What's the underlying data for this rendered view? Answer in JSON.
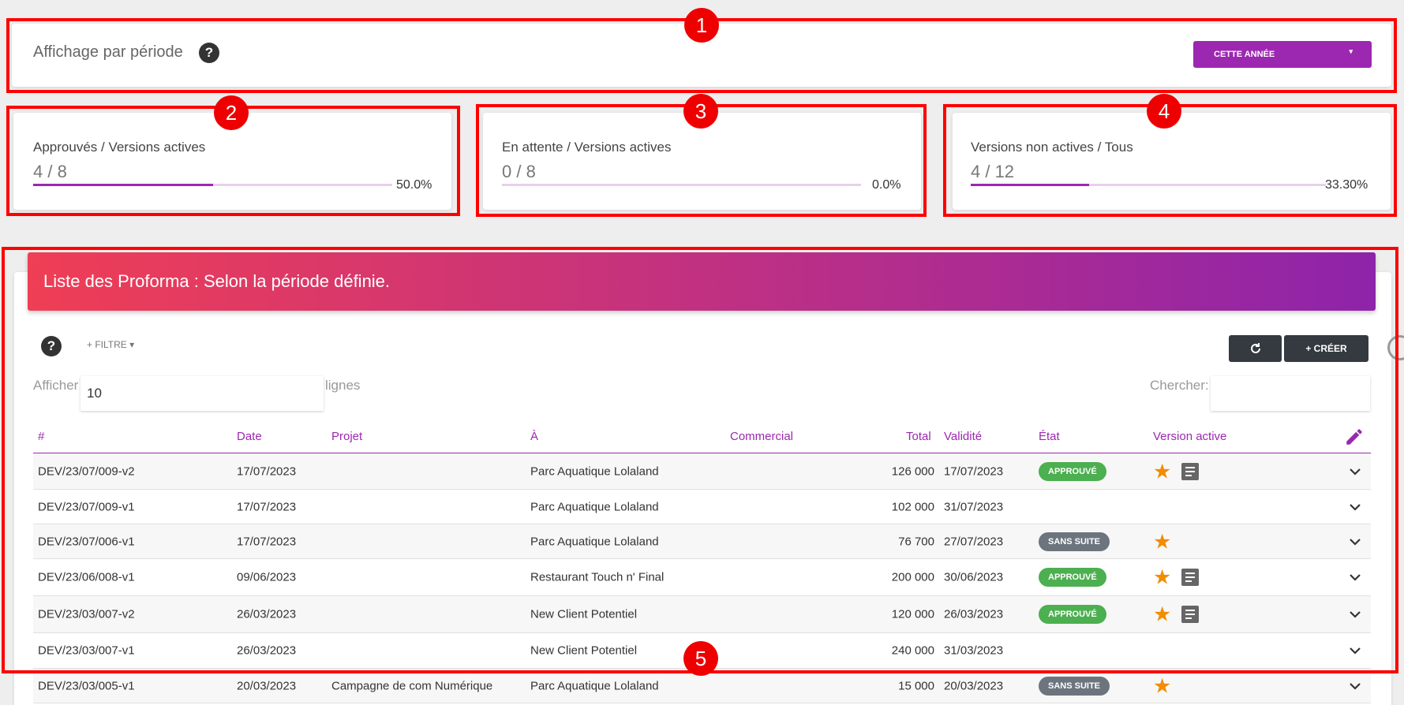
{
  "period": {
    "label": "Affichage par période",
    "help": "?",
    "button_label": "CETTE ANNÉE",
    "button_caret": "▾"
  },
  "stats": [
    {
      "title": "Approuvés / Versions actives",
      "value": "4 / 8",
      "percent": "50.0%",
      "progress": 0.5
    },
    {
      "title": "En attente / Versions actives",
      "value": "0 / 8",
      "percent": "0.0%",
      "progress": 0.0
    },
    {
      "title": "Versions non actives / Tous",
      "value": "4 / 12",
      "percent": "33.30%",
      "progress": 0.333
    }
  ],
  "annotations": [
    "1",
    "2",
    "3",
    "4",
    "5"
  ],
  "list": {
    "banner": "Liste des Proforma : Selon la période définie.",
    "help": "?",
    "filter_label": "+ FILTRE ▾",
    "refresh_icon": "refresh-icon",
    "create_label": "+ CRÉER",
    "show_label": "Afficher",
    "show_value": "10",
    "lines_label": "lignes",
    "search_label": "Chercher:",
    "search_value": "",
    "columns": [
      "#",
      "Date",
      "Projet",
      "À",
      "Commercial",
      "Total",
      "Validité",
      "État",
      "Version active"
    ],
    "rows": [
      {
        "id": "DEV/23/07/009-v2",
        "date": "17/07/2023",
        "projet": "",
        "a": "Parc Aquatique Lolaland",
        "commercial": "",
        "total": "126 000",
        "validite": "17/07/2023",
        "etat": "APPROUVÉ",
        "etat_color": "green",
        "star": true,
        "doc": true
      },
      {
        "id": "DEV/23/07/009-v1",
        "date": "17/07/2023",
        "projet": "",
        "a": "Parc Aquatique Lolaland",
        "commercial": "",
        "total": "102 000",
        "validite": "31/07/2023",
        "etat": "",
        "etat_color": "",
        "star": false,
        "doc": false
      },
      {
        "id": "DEV/23/07/006-v1",
        "date": "17/07/2023",
        "projet": "",
        "a": "Parc Aquatique Lolaland",
        "commercial": "",
        "total": "76 700",
        "validite": "27/07/2023",
        "etat": "SANS SUITE",
        "etat_color": "gray",
        "star": true,
        "doc": false
      },
      {
        "id": "DEV/23/06/008-v1",
        "date": "09/06/2023",
        "projet": "",
        "a": "Restaurant Touch n' Final",
        "commercial": "",
        "total": "200 000",
        "validite": "30/06/2023",
        "etat": "APPROUVÉ",
        "etat_color": "green",
        "star": true,
        "doc": true
      },
      {
        "id": "DEV/23/03/007-v2",
        "date": "26/03/2023",
        "projet": "",
        "a": "New Client Potentiel",
        "commercial": "",
        "total": "120 000",
        "validite": "26/03/2023",
        "etat": "APPROUVÉ",
        "etat_color": "green",
        "star": true,
        "doc": true
      },
      {
        "id": "DEV/23/03/007-v1",
        "date": "26/03/2023",
        "projet": "",
        "a": "New Client Potentiel",
        "commercial": "",
        "total": "240 000",
        "validite": "31/03/2023",
        "etat": "",
        "etat_color": "",
        "star": false,
        "doc": false
      },
      {
        "id": "DEV/23/03/005-v1",
        "date": "20/03/2023",
        "projet": "Campagne de com Numérique",
        "a": "Parc Aquatique Lolaland",
        "commercial": "",
        "total": "15 000",
        "validite": "20/03/2023",
        "etat": "SANS SUITE",
        "etat_color": "gray",
        "star": true,
        "doc": false
      }
    ]
  },
  "colors": {
    "accent": "#9c27b0",
    "annotation": "#ee0000",
    "approved": "#4caf50",
    "unfollowed": "#6c757d",
    "star": "#f28c00"
  }
}
